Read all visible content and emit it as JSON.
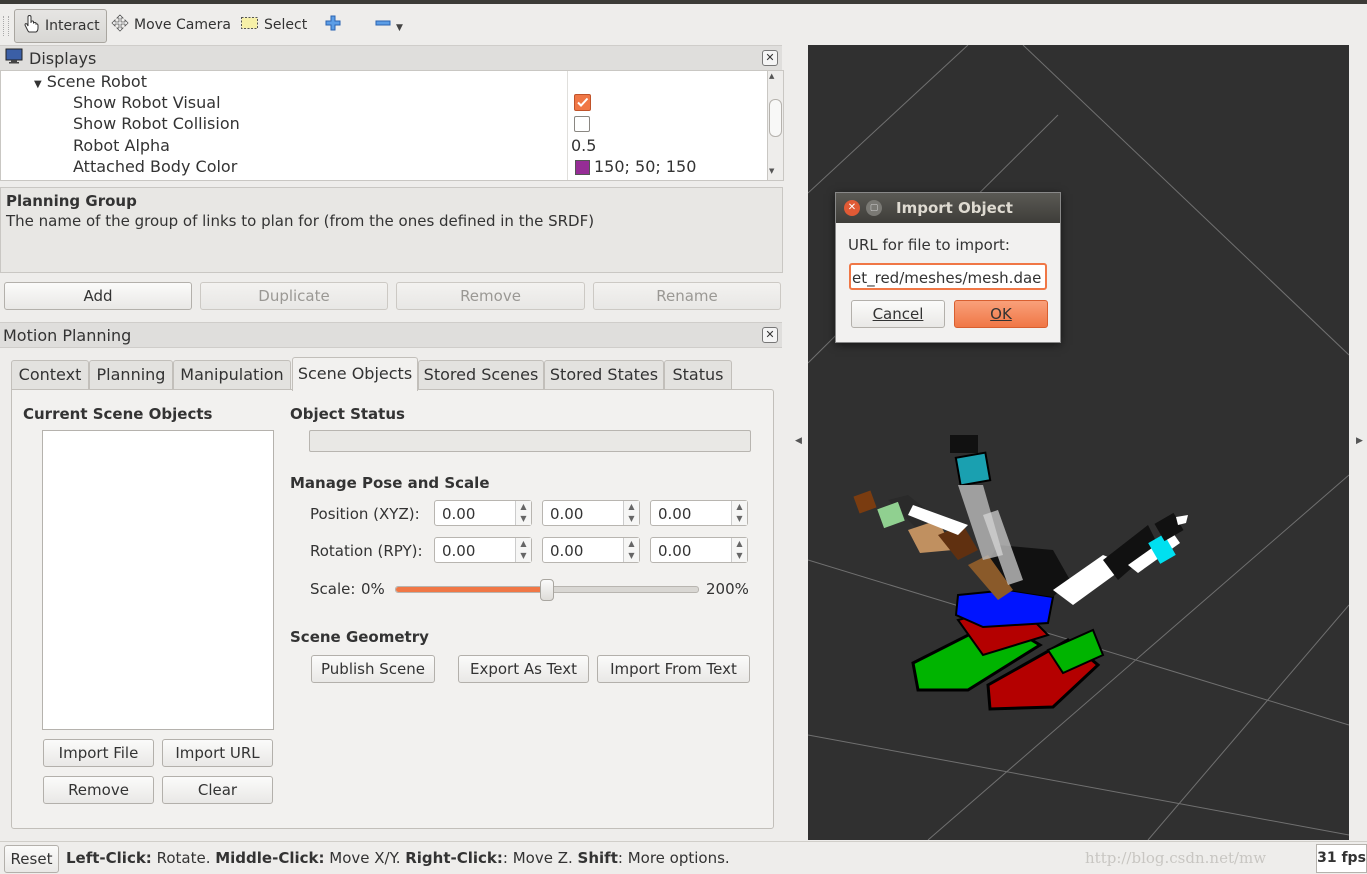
{
  "toolbar": {
    "interact": "Interact",
    "move_camera": "Move Camera",
    "select": "Select"
  },
  "displays": {
    "title": "Displays",
    "tree": {
      "root": "Scene Robot",
      "rows": [
        {
          "label": "Show Robot Visual",
          "value": ""
        },
        {
          "label": "Show Robot Collision",
          "value": ""
        },
        {
          "label": "Robot Alpha",
          "value": "0.5"
        },
        {
          "label": "Attached Body Color",
          "value": "150; 50; 150"
        }
      ],
      "show_robot_visual_checked": true,
      "show_robot_collision_checked": false,
      "attached_body_color": "#962d96"
    },
    "desc_title": "Planning Group",
    "desc_text": "The name of the group of links to plan for (from the ones defined in the SRDF)",
    "buttons": {
      "add": "Add",
      "duplicate": "Duplicate",
      "remove": "Remove",
      "rename": "Rename"
    }
  },
  "motion_planning": {
    "title": "Motion Planning",
    "tabs": [
      "Context",
      "Planning",
      "Manipulation",
      "Scene Objects",
      "Stored Scenes",
      "Stored States",
      "Status"
    ],
    "selected_tab": "Scene Objects",
    "current_scene_objects": "Current Scene Objects",
    "import_file": "Import File",
    "import_url": "Import URL",
    "remove": "Remove",
    "clear": "Clear",
    "object_status": "Object Status",
    "manage_pose": "Manage Pose and Scale",
    "position_label": "Position (XYZ):",
    "position": [
      "0.00",
      "0.00",
      "0.00"
    ],
    "rotation_label": "Rotation (RPY):",
    "rotation": [
      "0.00",
      "0.00",
      "0.00"
    ],
    "scale_label": "Scale:",
    "scale_min": "0%",
    "scale_max": "200%",
    "scale_fraction": 0.5,
    "scene_geometry": "Scene Geometry",
    "publish_scene": "Publish Scene",
    "export_as_text": "Export As Text",
    "import_from_text": "Import From Text"
  },
  "dialog": {
    "title": "Import Object",
    "label": "URL for file to import:",
    "value": "et_red/meshes/mesh.dae",
    "cancel": "Cancel",
    "ok": "OK"
  },
  "statusbar": {
    "reset": "Reset",
    "left_click": "Left-Click:",
    "rotate": " Rotate. ",
    "middle_click": "Middle-Click:",
    "move_xy": " Move X/Y. ",
    "right_click": "Right-Click:",
    "move_z": ": Move Z. ",
    "shift": "Shift",
    "more": ": More options.",
    "watermark": "http://blog.csdn.net/mw",
    "fps": "31 fps"
  },
  "colors": {
    "accent": "#f07746",
    "viewport_bg": "#303030",
    "robot_blue": "#0014ff",
    "robot_red": "#b40000",
    "robot_green": "#00b400"
  }
}
